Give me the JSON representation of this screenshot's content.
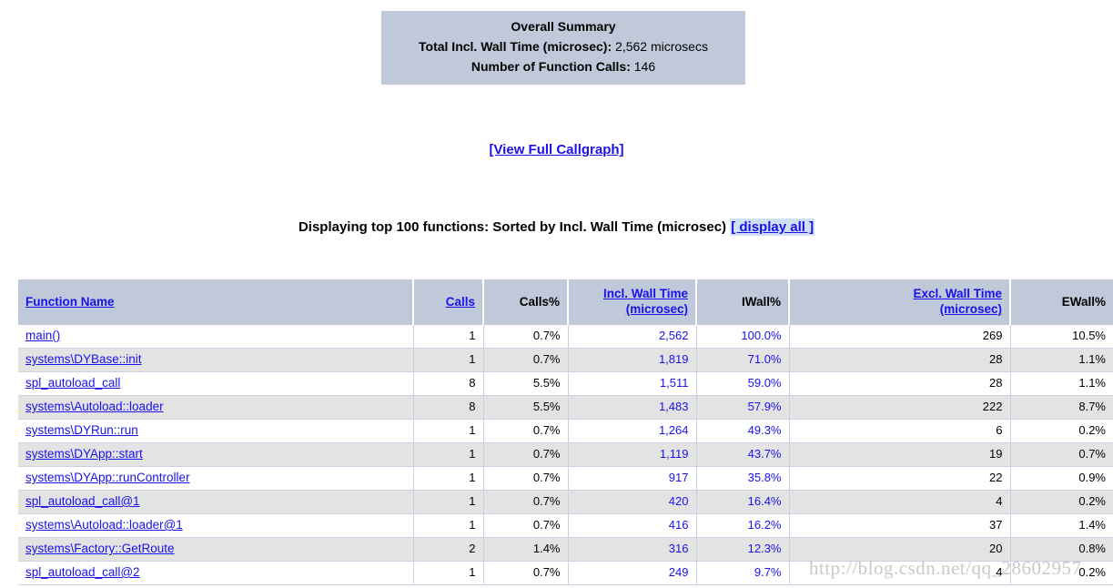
{
  "summary": {
    "title": "Overall Summary",
    "total_label": "Total Incl. Wall Time (microsec):",
    "total_value": "2,562 microsecs",
    "calls_label": "Number of Function Calls:",
    "calls_value": "146"
  },
  "callgraph": {
    "link_label": "[View Full Callgraph]"
  },
  "displaying": {
    "text": "Displaying top 100 functions: Sorted by Incl. Wall Time (microsec)",
    "display_all_label": "[ display all ]"
  },
  "table": {
    "headers": {
      "function_name": "Function Name",
      "calls": "Calls",
      "calls_pct": "Calls%",
      "incl_wall_time_l1": "Incl. Wall Time",
      "incl_wall_time_l2": "(microsec)",
      "iwall_pct": "IWall%",
      "excl_wall_time_l1": "Excl. Wall Time",
      "excl_wall_time_l2": "(microsec)",
      "ewall_pct": "EWall%"
    },
    "rows": [
      {
        "name": "main()",
        "calls": "1",
        "calls_pct": "0.7%",
        "incl": "2,562",
        "iwall_pct": "100.0%",
        "excl": "269",
        "ewall_pct": "10.5%"
      },
      {
        "name": "systems\\DYBase::init",
        "calls": "1",
        "calls_pct": "0.7%",
        "incl": "1,819",
        "iwall_pct": "71.0%",
        "excl": "28",
        "ewall_pct": "1.1%"
      },
      {
        "name": "spl_autoload_call",
        "calls": "8",
        "calls_pct": "5.5%",
        "incl": "1,511",
        "iwall_pct": "59.0%",
        "excl": "28",
        "ewall_pct": "1.1%"
      },
      {
        "name": "systems\\Autoload::loader",
        "calls": "8",
        "calls_pct": "5.5%",
        "incl": "1,483",
        "iwall_pct": "57.9%",
        "excl": "222",
        "ewall_pct": "8.7%"
      },
      {
        "name": "systems\\DYRun::run",
        "calls": "1",
        "calls_pct": "0.7%",
        "incl": "1,264",
        "iwall_pct": "49.3%",
        "excl": "6",
        "ewall_pct": "0.2%"
      },
      {
        "name": "systems\\DYApp::start",
        "calls": "1",
        "calls_pct": "0.7%",
        "incl": "1,119",
        "iwall_pct": "43.7%",
        "excl": "19",
        "ewall_pct": "0.7%"
      },
      {
        "name": "systems\\DYApp::runController",
        "calls": "1",
        "calls_pct": "0.7%",
        "incl": "917",
        "iwall_pct": "35.8%",
        "excl": "22",
        "ewall_pct": "0.9%"
      },
      {
        "name": "spl_autoload_call@1",
        "calls": "1",
        "calls_pct": "0.7%",
        "incl": "420",
        "iwall_pct": "16.4%",
        "excl": "4",
        "ewall_pct": "0.2%"
      },
      {
        "name": "systems\\Autoload::loader@1",
        "calls": "1",
        "calls_pct": "0.7%",
        "incl": "416",
        "iwall_pct": "16.2%",
        "excl": "37",
        "ewall_pct": "1.4%"
      },
      {
        "name": "systems\\Factory::GetRoute",
        "calls": "2",
        "calls_pct": "1.4%",
        "incl": "316",
        "iwall_pct": "12.3%",
        "excl": "20",
        "ewall_pct": "0.8%"
      },
      {
        "name": "spl_autoload_call@2",
        "calls": "1",
        "calls_pct": "0.7%",
        "incl": "249",
        "iwall_pct": "9.7%",
        "excl": "4",
        "ewall_pct": "0.2%"
      }
    ]
  },
  "watermark": {
    "text": "http://blog.csdn.net/qq_28602957"
  },
  "colors": {
    "header_bg": "#bfc9da",
    "link": "#1a12ee",
    "row_alt_bg": "#e3e3e3",
    "highlight_bg": "#cfe0f5"
  }
}
